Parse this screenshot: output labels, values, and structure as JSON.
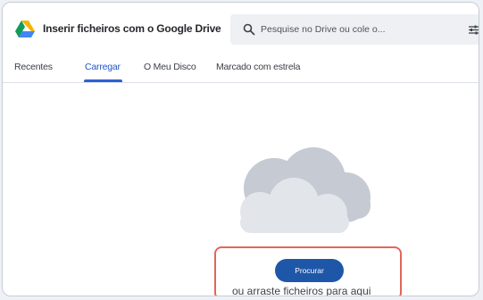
{
  "header": {
    "title": "Inserir ficheiros com o Google Drive",
    "logo_icon": "google-drive-logo",
    "search_placeholder": "Pesquise no Drive ou cole o...",
    "search_icon": "search-icon",
    "filter_icon": "filter-sliders-icon"
  },
  "tabs": [
    {
      "label": "Recentes",
      "active": false
    },
    {
      "label": "Carregar",
      "active": true
    },
    {
      "label": "O Meu Disco",
      "active": false
    },
    {
      "label": "Marcado com estrela",
      "active": false
    }
  ],
  "upload": {
    "illustration": "cloud-illustration",
    "browse_label": "Procurar",
    "drag_text": "ou arraste ficheiros para aqui"
  },
  "colors": {
    "accent": "#2f60d2",
    "button": "#1f57a8",
    "highlight": "#e2665b"
  }
}
